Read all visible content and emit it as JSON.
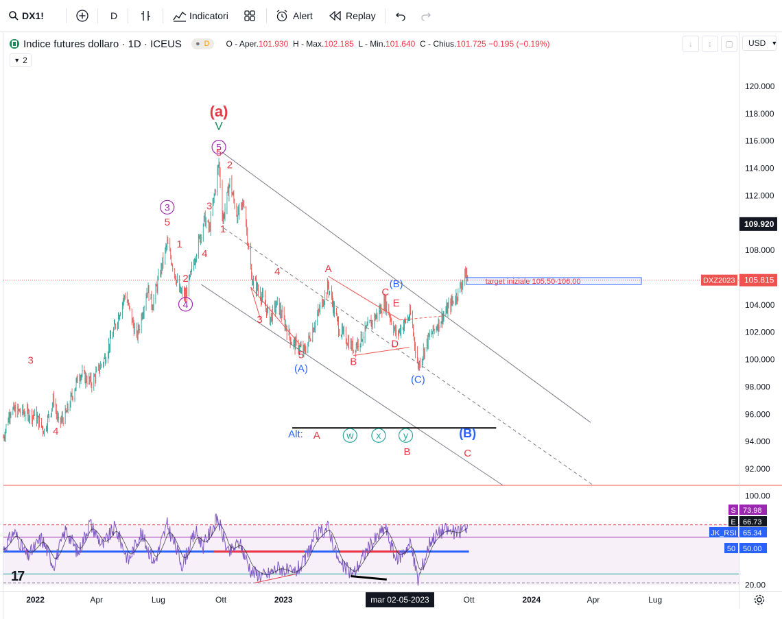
{
  "toolbar": {
    "symbol": "DX1!",
    "interval": "D",
    "indicators_label": "Indicatori",
    "alert_label": "Alert",
    "replay_label": "Replay"
  },
  "legend": {
    "title": "Indice futures dollaro · 1D · ICEUS",
    "badge_letter": "D",
    "open_label": "O - Aper.",
    "open": "101.930",
    "high_label": "H - Max.",
    "high": "102.185",
    "low_label": "L - Min.",
    "low": "101.640",
    "close_label": "C - Chius.",
    "close": "101.725",
    "change": "−0.195 (−0.19%)",
    "collapse_count": "2"
  },
  "currency": "USD",
  "cursor_date": "mar 02-05-2023",
  "colors": {
    "up": "#26a69a",
    "down": "#ef5350",
    "wave_red": "#e53945",
    "wave_purple": "#9c27b0",
    "wave_blue": "#2962ff",
    "wave_green": "#1b8a5a",
    "rsi": "#7e57c2"
  },
  "chart_data": [
    {
      "type": "candlestick",
      "title": "Indice futures dollaro · 1D · ICEUS",
      "x_ticks": [
        "2022",
        "Apr",
        "Lug",
        "Ott",
        "2023",
        "mar 02-05-2023",
        "Lug",
        "Ott",
        "2024",
        "Apr",
        "Lug"
      ],
      "y_ticks": [
        "120.000",
        "118.000",
        "116.000",
        "114.000",
        "112.000",
        "110.000",
        "108.000",
        "106.000",
        "104.000",
        "102.000",
        "100.000",
        "98.000",
        "96.000",
        "94.000",
        "92.000"
      ],
      "ylim": [
        90.8,
        121.5
      ],
      "price_path": [
        [
          "2021-11-15",
          94.3
        ],
        [
          "2021-11-25",
          96.3
        ],
        [
          "2021-12-10",
          96.2
        ],
        [
          "2022-01-01",
          95.9
        ],
        [
          "2022-01-14",
          94.8
        ],
        [
          "2022-01-28",
          97.1
        ],
        [
          "2022-02-04",
          95.3
        ],
        [
          "2022-02-15",
          96.0
        ],
        [
          "2022-03-07",
          99.0
        ],
        [
          "2022-03-25",
          98.3
        ],
        [
          "2022-04-14",
          100.2
        ],
        [
          "2022-05-13",
          104.8
        ],
        [
          "2022-05-30",
          101.6
        ],
        [
          "2022-06-15",
          105.2
        ],
        [
          "2022-06-22",
          104.0
        ],
        [
          "2022-07-14",
          108.5
        ],
        [
          "2022-08-01",
          105.0
        ],
        [
          "2022-08-10",
          104.6
        ],
        [
          "2022-08-30",
          108.8
        ],
        [
          "2022-09-07",
          110.3
        ],
        [
          "2022-09-14",
          109.5
        ],
        [
          "2022-09-28",
          114.4
        ],
        [
          "2022-10-04",
          110.2
        ],
        [
          "2022-10-14",
          113.0
        ],
        [
          "2022-10-25",
          110.5
        ],
        [
          "2022-11-04",
          111.5
        ],
        [
          "2022-11-15",
          106.0
        ],
        [
          "2022-12-01",
          104.5
        ],
        [
          "2022-12-12",
          103.0
        ],
        [
          "2022-12-23",
          104.1
        ],
        [
          "2023-01-13",
          101.3
        ],
        [
          "2023-02-01",
          100.6
        ],
        [
          "2023-03-08",
          105.4
        ],
        [
          "2023-03-24",
          102.2
        ],
        [
          "2023-04-14",
          100.8
        ],
        [
          "2023-05-31",
          104.2
        ],
        [
          "2023-06-16",
          101.8
        ],
        [
          "2023-07-07",
          103.3
        ],
        [
          "2023-07-18",
          99.5
        ],
        [
          "2023-08-02",
          101.5
        ],
        [
          "2023-08-25",
          103.3
        ],
        [
          "2023-09-14",
          104.8
        ],
        [
          "2023-09-27",
          106.4
        ],
        [
          "2023-09-29",
          105.8
        ]
      ],
      "last_price": "105.815",
      "symbol_tag": "DXZ2023",
      "crosshair_price": "109.920",
      "target_label": "target iniziale 105,50-106,00",
      "target_range": [
        105.5,
        106.0
      ],
      "wave_labels": [
        {
          "t": "(a)",
          "color": "red",
          "date": "2022-09-28",
          "price": 117.8,
          "size": 22
        },
        {
          "t": "V",
          "color": "green",
          "date": "2022-09-28",
          "price": 116.8,
          "size": 17
        },
        {
          "t": "5",
          "color": "purple",
          "circle": true,
          "date": "2022-09-28",
          "price": 115.3
        },
        {
          "t": "5",
          "color": "red",
          "date": "2022-09-28",
          "price": 114.9
        },
        {
          "t": "2",
          "color": "red",
          "date": "2022-10-14",
          "price": 114.0
        },
        {
          "t": "3",
          "color": "red",
          "date": "2022-09-14",
          "price": 111.0
        },
        {
          "t": "1",
          "color": "red",
          "date": "2022-10-04",
          "price": 109.3
        },
        {
          "t": "4",
          "color": "red",
          "date": "2022-09-07",
          "price": 107.5
        },
        {
          "t": "3",
          "color": "purple",
          "circle": true,
          "date": "2022-07-14",
          "price": 110.9
        },
        {
          "t": "5",
          "color": "red",
          "date": "2022-07-14",
          "price": 109.8
        },
        {
          "t": "1",
          "color": "red",
          "date": "2022-08-01",
          "price": 108.2
        },
        {
          "t": "2",
          "color": "red",
          "date": "2022-08-10",
          "price": 105.7
        },
        {
          "t": "4",
          "color": "purple",
          "circle": true,
          "date": "2022-08-10",
          "price": 103.8
        },
        {
          "t": "3",
          "color": "red",
          "date": "2021-12-25",
          "price": 99.7
        },
        {
          "t": "4",
          "color": "red",
          "date": "2022-01-31",
          "price": 94.5
        },
        {
          "t": "4",
          "color": "red",
          "date": "2022-12-23",
          "price": 106.2
        },
        {
          "t": "3",
          "color": "red",
          "date": "2022-11-27",
          "price": 102.7
        },
        {
          "t": "5",
          "color": "red",
          "date": "2023-01-27",
          "price": 100.1
        },
        {
          "t": "(A)",
          "color": "blue",
          "date": "2023-01-27",
          "price": 99.1
        },
        {
          "t": "A",
          "color": "red",
          "date": "2023-03-08",
          "price": 106.4
        },
        {
          "t": "B",
          "color": "red",
          "date": "2023-04-14",
          "price": 99.6
        },
        {
          "t": "C",
          "color": "red",
          "date": "2023-05-31",
          "price": 104.7
        },
        {
          "t": "E",
          "color": "red",
          "date": "2023-06-16",
          "price": 103.9
        },
        {
          "t": "D",
          "color": "red",
          "date": "2023-06-14",
          "price": 100.9
        },
        {
          "t": "(B)",
          "color": "blue",
          "date": "2023-06-16",
          "price": 105.3
        },
        {
          "t": "(C)",
          "color": "blue",
          "date": "2023-07-18",
          "price": 98.3
        },
        {
          "t": "Alt:",
          "color": "blue",
          "date": "2023-01-19",
          "price": 94.3
        },
        {
          "t": "A",
          "color": "red",
          "date": "2023-02-19",
          "price": 94.2
        },
        {
          "t": "w",
          "color": "teal",
          "circle": true,
          "date": "2023-04-09",
          "price": 94.2
        },
        {
          "t": "x",
          "color": "teal",
          "circle": true,
          "date": "2023-05-21",
          "price": 94.2
        },
        {
          "t": "y",
          "color": "teal",
          "circle": true,
          "date": "2023-06-30",
          "price": 94.2
        },
        {
          "t": "B",
          "color": "red",
          "date": "2023-07-02",
          "price": 93.0
        },
        {
          "t": "(B)",
          "color": "blue",
          "date": "2023-09-29",
          "price": 94.3,
          "size": 18
        },
        {
          "t": "C",
          "color": "red",
          "date": "2023-09-29",
          "price": 92.9
        }
      ]
    },
    {
      "type": "line",
      "title": "JK_RSI",
      "ylim": [
        16,
        102
      ],
      "y_ticks": [
        "100.00",
        "20.00"
      ],
      "levels": [
        {
          "name": "S",
          "value": "73.98",
          "color": "#9c27b0"
        },
        {
          "name": "E",
          "value": "66.73",
          "color": "#131722"
        },
        {
          "name": "JK_RSI",
          "value": "65.34",
          "color": "#2962ff"
        },
        {
          "name": "50",
          "value": "50.00",
          "color": "#2962ff"
        }
      ],
      "rsi_path": [
        [
          "2021-11-15",
          52
        ],
        [
          "2021-12-01",
          68
        ],
        [
          "2021-12-20",
          45
        ],
        [
          "2022-01-10",
          62
        ],
        [
          "2022-01-28",
          38
        ],
        [
          "2022-02-15",
          70
        ],
        [
          "2022-03-05",
          48
        ],
        [
          "2022-03-22",
          76
        ],
        [
          "2022-04-10",
          55
        ],
        [
          "2022-04-28",
          72
        ],
        [
          "2022-05-18",
          42
        ],
        [
          "2022-06-05",
          67
        ],
        [
          "2022-06-25",
          40
        ],
        [
          "2022-07-14",
          74
        ],
        [
          "2022-08-05",
          38
        ],
        [
          "2022-08-25",
          68
        ],
        [
          "2022-09-05",
          55
        ],
        [
          "2022-09-26",
          80
        ],
        [
          "2022-10-12",
          48
        ],
        [
          "2022-10-28",
          58
        ],
        [
          "2022-11-15",
          32
        ],
        [
          "2022-12-05",
          28
        ],
        [
          "2022-12-25",
          36
        ],
        [
          "2023-01-15",
          30
        ],
        [
          "2023-01-31",
          40
        ],
        [
          "2023-02-15",
          62
        ],
        [
          "2023-03-08",
          72
        ],
        [
          "2023-03-25",
          38
        ],
        [
          "2023-04-14",
          30
        ],
        [
          "2023-05-02",
          50
        ],
        [
          "2023-05-31",
          72
        ],
        [
          "2023-06-16",
          42
        ],
        [
          "2023-07-07",
          58
        ],
        [
          "2023-07-18",
          24
        ],
        [
          "2023-08-05",
          60
        ],
        [
          "2023-08-25",
          70
        ],
        [
          "2023-09-14",
          66
        ],
        [
          "2023-09-29",
          74
        ]
      ]
    }
  ]
}
